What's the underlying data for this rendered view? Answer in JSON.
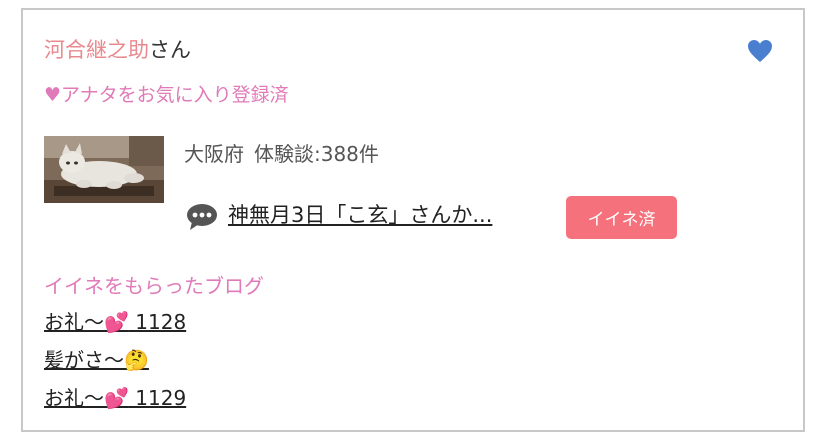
{
  "user": {
    "name": "河合継之助",
    "suffix": "さん"
  },
  "favorite_status": "♥アナタをお気に入り登録済",
  "heart_icon_color": "#4a7fd0",
  "profile": {
    "prefecture": "大阪府",
    "reviews": "体験談:388件"
  },
  "latest_post": {
    "title": "神無月3日「こ玄」さんか...",
    "icon": "speech-bubble-icon"
  },
  "iine_button": {
    "label": "イイネ済",
    "color": "#f5717c"
  },
  "liked_blogs": {
    "heading": "イイネをもらったブログ",
    "items": [
      {
        "text": "お礼〜",
        "emoji": "💕",
        "suffix": " 1128"
      },
      {
        "text": "髪がさ〜",
        "emoji": "🤔",
        "suffix": ""
      },
      {
        "text": "お礼〜",
        "emoji": "💕",
        "suffix": " 1129"
      }
    ]
  }
}
